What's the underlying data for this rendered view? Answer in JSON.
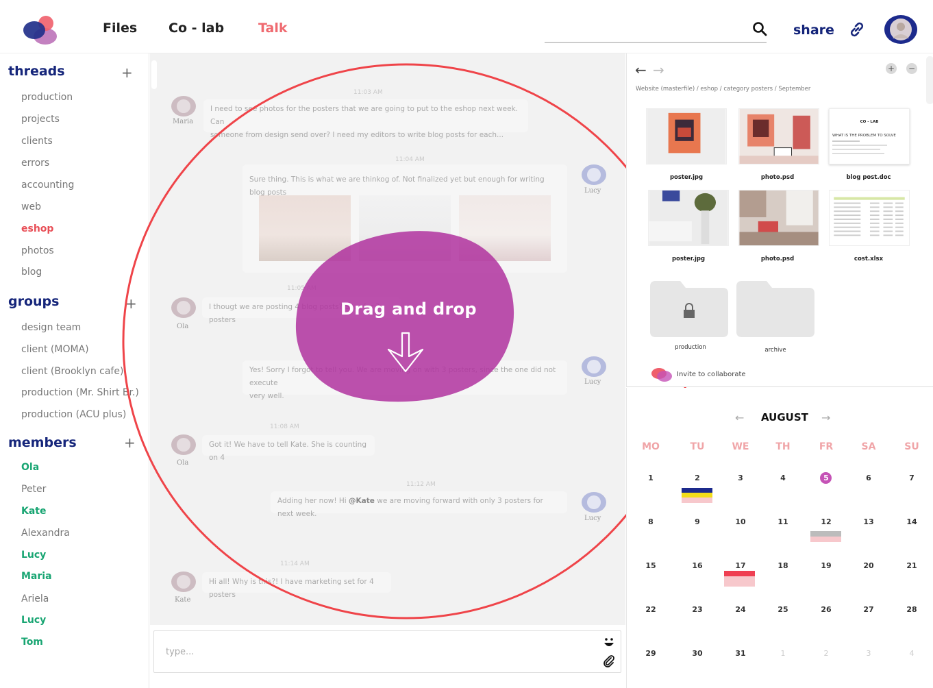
{
  "nav": {
    "files": "Files",
    "colab": "Co - lab",
    "talk": "Talk",
    "share": "share",
    "search_placeholder": ""
  },
  "sidebar": {
    "threads_title": "threads",
    "threads": [
      "production",
      "projects",
      "clients",
      "errors",
      "accounting",
      "web",
      "eshop",
      "photos",
      "blog"
    ],
    "active_thread": "eshop",
    "groups_title": "groups",
    "groups": [
      "design team",
      "client (MOMA)",
      "client (Brooklyn cafe)",
      "production (Mr. Shirt Br.)",
      "production (ACU plus)"
    ],
    "members_title": "members",
    "members": [
      {
        "name": "Ola",
        "online": true
      },
      {
        "name": "Peter",
        "online": false
      },
      {
        "name": "Kate",
        "online": true
      },
      {
        "name": "Alexandra",
        "online": false
      },
      {
        "name": "Lucy",
        "online": true
      },
      {
        "name": "Maria",
        "online": true
      },
      {
        "name": "Ariela",
        "online": false
      },
      {
        "name": "Lucy",
        "online": true
      },
      {
        "name": "Tom",
        "online": true
      }
    ],
    "add_symbol": "+"
  },
  "chat": {
    "messages": [
      {
        "time": "11:03 AM",
        "author": "Maria",
        "text1": "I need to see photos for the posters that we are going to put to the eshop next week. Can",
        "text2": "someone from design send over? I need my editors to write blog posts for each..."
      },
      {
        "time": "11:04 AM",
        "author": "Lucy",
        "text1": "Sure thing. This is what we are thinkog of. Not finalized yet but enough for writing blog posts"
      },
      {
        "time": "11:05 AM",
        "author": "Ola",
        "text1": "I thougt we are posting 4 blog posts? Sh... for 3 posters"
      },
      {
        "time": "",
        "author": "Lucy",
        "text1": "Yes! Sorry I forgot to tell you. We are moving on with 3 posters, since the one did not execute",
        "text2": "very well."
      },
      {
        "time": "11:08 AM",
        "author": "Ola",
        "text1": "Got it! We have to tell Kate. She is counting on 4"
      },
      {
        "time": "11:12 AM",
        "author": "Lucy",
        "text_pre": "Adding her now! Hi ",
        "mention": "@Kate",
        "text_post": " we are moving forward with only 3 posters for next week."
      },
      {
        "time": "11:14 AM",
        "author": "Kate",
        "text1": "Hi all! Why is this?! I have marketing set for 4 posters"
      }
    ],
    "drag_drop_label": "Drag and drop",
    "input_placeholder": "type..."
  },
  "files_panel": {
    "breadcrumb": "Website (masterfile) / eshop / category posters / September",
    "files": [
      {
        "name": "poster.jpg"
      },
      {
        "name": "photo.psd"
      },
      {
        "name": "blog post.doc",
        "doc_title": "CO - LAB",
        "doc_heading": "WHAT IS THE PROBLEM TO SOLVE"
      },
      {
        "name": "poster.jpg"
      },
      {
        "name": "photo.psd"
      },
      {
        "name": "cost.xlsx"
      }
    ],
    "folders": [
      {
        "name": "production",
        "locked": true
      },
      {
        "name": "archive",
        "locked": false
      }
    ],
    "invite": "Invite to collaborate",
    "zoom_in": "+",
    "zoom_out": "−"
  },
  "calendar": {
    "month": "AUGUST",
    "weekdays": [
      "MO",
      "TU",
      "WE",
      "TH",
      "FR",
      "SA",
      "SU"
    ],
    "weeks": [
      [
        "1",
        "2",
        "3",
        "4",
        "5",
        "6",
        "7"
      ],
      [
        "8",
        "9",
        "10",
        "11",
        "12",
        "13",
        "14"
      ],
      [
        "15",
        "16",
        "17",
        "18",
        "19",
        "20",
        "21"
      ],
      [
        "22",
        "23",
        "24",
        "25",
        "26",
        "27",
        "28"
      ],
      [
        "29",
        "30",
        "31",
        "1",
        "2",
        "3",
        "4"
      ]
    ],
    "today": "5",
    "colors": {
      "accent": "#c552b6",
      "weekday": "#f0a5a8",
      "brand": "#15257a",
      "online": "#18a572",
      "active": "#e84e56"
    }
  }
}
